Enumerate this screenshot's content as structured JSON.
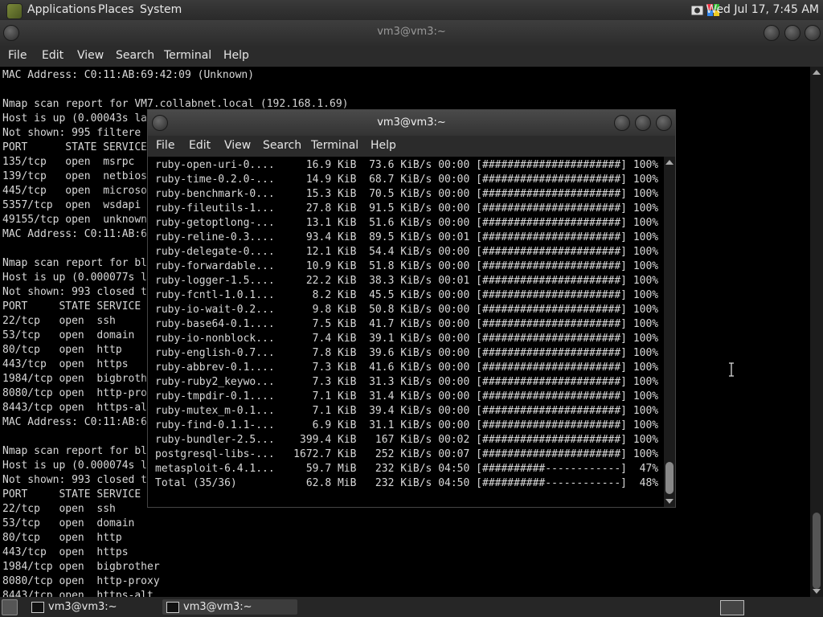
{
  "top_panel": {
    "menus": [
      "Applications",
      "Places",
      "System"
    ],
    "clock": "Wed Jul 17, 7:45 AM"
  },
  "back_window": {
    "title": "vm3@vm3:~",
    "menu": [
      "File",
      "Edit",
      "View",
      "Search",
      "Terminal",
      "Help"
    ],
    "lines": [
      "MAC Address: C0:11:AB:69:42:09 (Unknown)",
      "",
      "Nmap scan report for VM7.collabnet.local (192.168.1.69)",
      "Host is up (0.00043s la",
      "Not shown: 995 filtere",
      "PORT      STATE SERVICE",
      "135/tcp   open  msrpc",
      "139/tcp   open  netbios",
      "445/tcp   open  microso",
      "5357/tcp  open  wsdapi",
      "49155/tcp open  unknown",
      "MAC Address: C0:11:AB:6",
      "",
      "Nmap scan report for bl",
      "Host is up (0.000077s l",
      "Not shown: 993 closed t",
      "PORT     STATE SERVICE",
      "22/tcp   open  ssh",
      "53/tcp   open  domain",
      "80/tcp   open  http",
      "443/tcp  open  https",
      "1984/tcp open  bigbroth",
      "8080/tcp open  http-pro",
      "8443/tcp open  https-al",
      "MAC Address: C0:11:AB:6",
      "",
      "Nmap scan report for bl",
      "Host is up (0.000074s l",
      "Not shown: 993 closed t",
      "PORT     STATE SERVICE",
      "22/tcp   open  ssh",
      "53/tcp   open  domain",
      "80/tcp   open  http",
      "443/tcp  open  https",
      "1984/tcp open  bigbrother",
      "8080/tcp open  http-proxy",
      "8443/tcp open  https-alt"
    ]
  },
  "front_window": {
    "title": "vm3@vm3:~",
    "menu": [
      "File",
      "Edit",
      "View",
      "Search",
      "Terminal",
      "Help"
    ],
    "lines": [
      "ruby-open-uri-0....     16.9 KiB  73.6 KiB/s 00:00 [######################] 100%",
      "ruby-time-0.2.0-...     14.9 KiB  68.7 KiB/s 00:00 [######################] 100%",
      "ruby-benchmark-0...     15.3 KiB  70.5 KiB/s 00:00 [######################] 100%",
      "ruby-fileutils-1...     27.8 KiB  91.5 KiB/s 00:00 [######################] 100%",
      "ruby-getoptlong-...     13.1 KiB  51.6 KiB/s 00:00 [######################] 100%",
      "ruby-reline-0.3....     93.4 KiB  89.5 KiB/s 00:01 [######################] 100%",
      "ruby-delegate-0....     12.1 KiB  54.4 KiB/s 00:00 [######################] 100%",
      "ruby-forwardable...     10.9 KiB  51.8 KiB/s 00:00 [######################] 100%",
      "ruby-logger-1.5....     22.2 KiB  38.3 KiB/s 00:01 [######################] 100%",
      "ruby-fcntl-1.0.1...      8.2 KiB  45.5 KiB/s 00:00 [######################] 100%",
      "ruby-io-wait-0.2...      9.8 KiB  50.8 KiB/s 00:00 [######################] 100%",
      "ruby-base64-0.1....      7.5 KiB  41.7 KiB/s 00:00 [######################] 100%",
      "ruby-io-nonblock...      7.4 KiB  39.1 KiB/s 00:00 [######################] 100%",
      "ruby-english-0.7...      7.8 KiB  39.6 KiB/s 00:00 [######################] 100%",
      "ruby-abbrev-0.1....      7.3 KiB  41.6 KiB/s 00:00 [######################] 100%",
      "ruby-ruby2_keywo...      7.3 KiB  31.3 KiB/s 00:00 [######################] 100%",
      "ruby-tmpdir-0.1....      7.1 KiB  31.4 KiB/s 00:00 [######################] 100%",
      "ruby-mutex_m-0.1...      7.1 KiB  39.4 KiB/s 00:00 [######################] 100%",
      "ruby-find-0.1.1-...      6.9 KiB  31.1 KiB/s 00:00 [######################] 100%",
      "ruby-bundler-2.5...    399.4 KiB   167 KiB/s 00:02 [######################] 100%",
      "postgresql-libs-...   1672.7 KiB   252 KiB/s 00:07 [######################] 100%",
      "metasploit-6.4.1...     59.7 MiB   232 KiB/s 04:50 [##########------------]  47%",
      "Total (35/36)           62.8 MiB   232 KiB/s 04:50 [##########------------]  48%"
    ]
  },
  "taskbar": {
    "tasks": [
      "vm3@vm3:~",
      "vm3@vm3:~"
    ]
  },
  "colors": {
    "terminal_bg": "#000000",
    "terminal_fg": "#d8d8d8",
    "panel_bg": "#2b2b2b"
  }
}
